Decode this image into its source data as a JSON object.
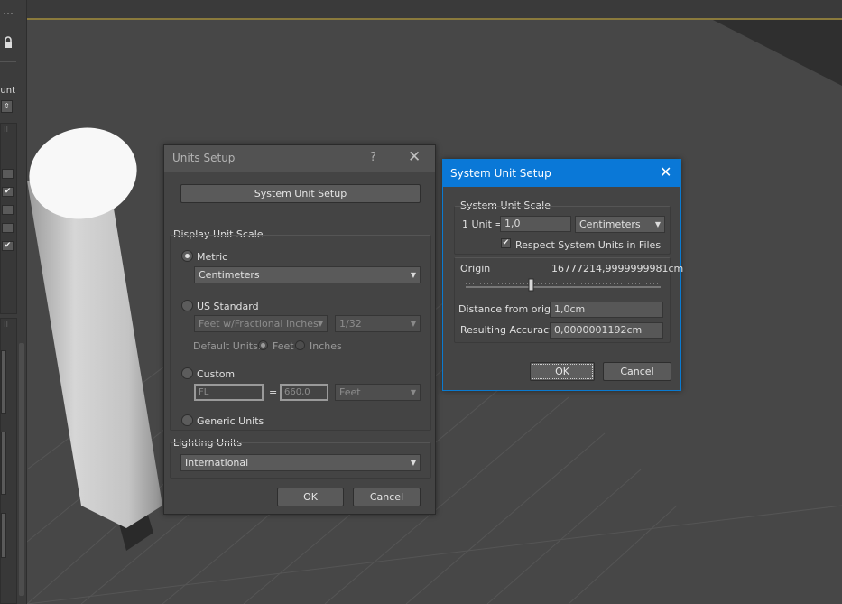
{
  "left_panel": {
    "more_icon": "⋯",
    "lock_icon": "🔒",
    "truncated_label": "ount",
    "checks": [
      "✔",
      "✔"
    ]
  },
  "units_setup": {
    "title": "Units Setup",
    "help_label": "?",
    "close_label": "✕",
    "system_unit_setup_button": "System Unit Setup",
    "display_unit_scale": {
      "label": "Display Unit Scale",
      "metric_label": "Metric",
      "metric_selected": "Centimeters",
      "us_standard_label": "US Standard",
      "us_standard_selected": "Feet w/Fractional Inches",
      "fraction_selected": "1/32",
      "default_units_label": "Default Units:",
      "feet_label": "Feet",
      "inches_label": "Inches",
      "custom_label": "Custom",
      "custom_name_value": "FL",
      "equals": "=",
      "custom_amount_value": "660,0",
      "custom_unit_selected": "Feet",
      "generic_units_label": "Generic Units",
      "selected": "Metric"
    },
    "lighting_units": {
      "label": "Lighting Units",
      "selected": "International"
    },
    "ok_label": "OK",
    "cancel_label": "Cancel"
  },
  "system_unit_setup": {
    "title": "System Unit Setup",
    "close_label": "✕",
    "scale_group_label": "System Unit Scale",
    "unit_label": "1 Unit =",
    "unit_value": "1,0",
    "unit_selected": "Centimeters",
    "respect_label": "Respect System Units in Files",
    "respect_checked": true,
    "check_glyph": "✔",
    "origin_label": "Origin",
    "origin_value": "16777214,9999999981cm",
    "origin_slider_fraction": 0.33,
    "distance_label": "Distance from origin:",
    "distance_value": "1,0cm",
    "accuracy_label": "Resulting Accuracy:",
    "accuracy_value": "0,0000001192cm",
    "ok_label": "OK",
    "cancel_label": "Cancel"
  },
  "colors": {
    "accent": "#0a78d7",
    "viewport_bg": "#474747",
    "dialog_bg": "#444444"
  }
}
